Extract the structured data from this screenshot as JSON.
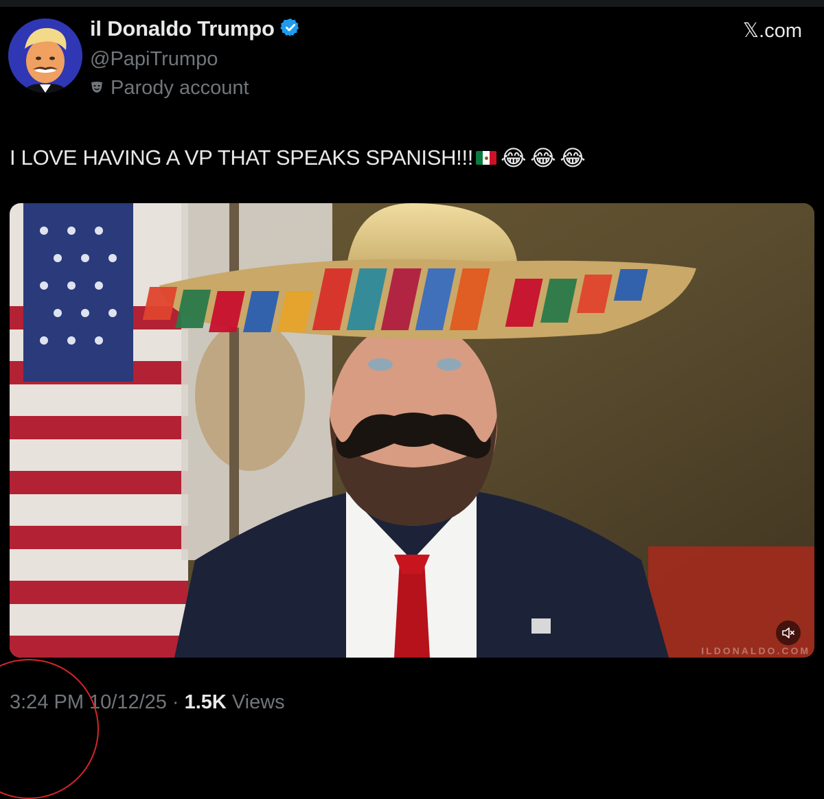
{
  "author": {
    "display_name": "il Donaldo Trumpo",
    "handle": "@PapiTrumpo",
    "label": "Parody account",
    "verified": true
  },
  "site": "𝕏.com",
  "post": {
    "text": "I LOVE HAVING A VP THAT SPEAKS SPANISH!!!",
    "flag_icon": "mexico-flag-icon",
    "emojis": [
      "😂",
      "😂",
      "😂"
    ]
  },
  "media": {
    "watermark": "ILDONALDO.COM",
    "muted": true
  },
  "meta": {
    "time": "3:24 PM",
    "date": "10/12/25",
    "separator": "·",
    "views_count": "1.5K",
    "views_label": "Views"
  },
  "colors": {
    "background": "#000000",
    "text_primary": "#e7e9ea",
    "text_secondary": "#71767b",
    "verified_blue": "#1d9bf0",
    "annotation_red": "#d6262b"
  }
}
